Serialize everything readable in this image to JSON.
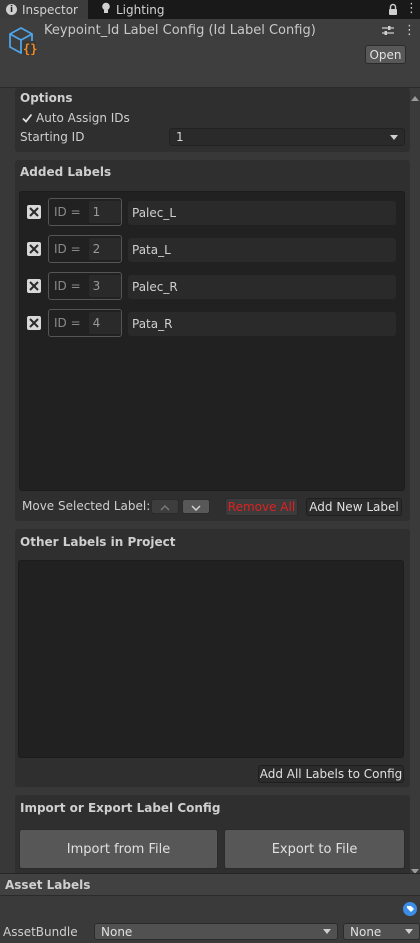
{
  "tabs": [
    {
      "label": "Inspector",
      "icon": "info-icon"
    },
    {
      "label": "Lighting",
      "icon": "bulb-icon"
    }
  ],
  "header": {
    "title": "Keypoint_Id Label Config (Id Label Config)",
    "open_label": "Open"
  },
  "options": {
    "title": "Options",
    "auto_assign_label": "Auto Assign IDs",
    "auto_assign_checked": true,
    "starting_id_label": "Starting ID",
    "starting_id_value": "1"
  },
  "added_labels": {
    "title": "Added Labels",
    "id_prefix": "ID =",
    "rows": [
      {
        "id": "1",
        "name": "Palec_L"
      },
      {
        "id": "2",
        "name": "Pata_L"
      },
      {
        "id": "3",
        "name": "Palec_R"
      },
      {
        "id": "4",
        "name": "Pata_R"
      }
    ],
    "move_label": "Move Selected Label:",
    "remove_all": "Remove All",
    "add_new": "Add New Label"
  },
  "other_labels": {
    "title": "Other Labels in Project",
    "add_all": "Add All Labels to Config"
  },
  "import_export": {
    "title": "Import or Export Label Config",
    "import": "Import from File",
    "export": "Export to File"
  },
  "asset_labels": {
    "title": "Asset Labels",
    "bundle_label": "AssetBundle",
    "bundle_value": "None",
    "variant_value": "None"
  },
  "colors": {
    "accent": "#3a8ee6",
    "remove_red": "#e02020"
  }
}
